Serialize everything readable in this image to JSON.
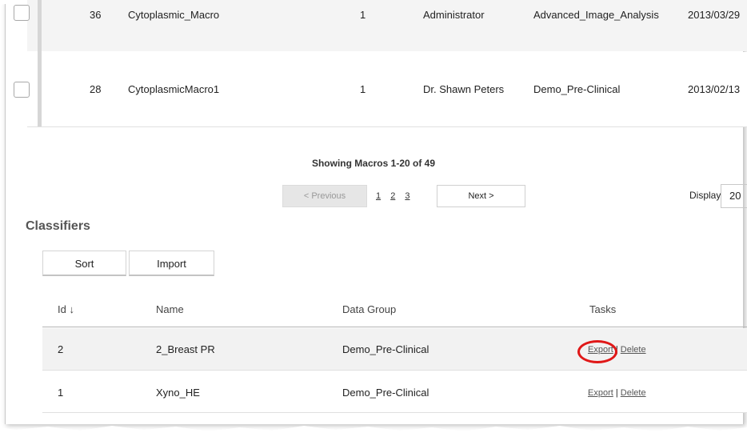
{
  "macros": {
    "rows": [
      {
        "id": "36",
        "name": "Cytoplasmic_Macro",
        "version": "1",
        "owner": "Administrator",
        "data_group": "Advanced_Image_Analysis",
        "date": "2013/03/29"
      },
      {
        "id": "28",
        "name": "CytoplasmicMacro1",
        "version": "1",
        "owner": "Dr. Shawn Peters",
        "data_group": "Demo_Pre-Clinical",
        "date": "2013/02/13"
      }
    ],
    "showing_text": "Showing Macros 1-20 of 49",
    "pagination": {
      "previous_label": "<   Previous",
      "pages": [
        "1",
        "2",
        "3"
      ],
      "next_label": "Next     >"
    },
    "display_label": "Display",
    "display_value": "20"
  },
  "classifiers": {
    "title": "Classifiers",
    "sort_label": "Sort",
    "import_label": "Import",
    "headers": {
      "id": "Id ↓",
      "name": "Name",
      "data_group": "Data Group",
      "tasks": "Tasks"
    },
    "rows": [
      {
        "id": "2",
        "name": "2_Breast PR",
        "data_group": "Demo_Pre-Clinical",
        "export": "Export",
        "sep": "|",
        "delete": "Delete"
      },
      {
        "id": "1",
        "name": "Xyno_HE",
        "data_group": "Demo_Pre-Clinical",
        "export": "Export",
        "sep": "|",
        "delete": "Delete"
      }
    ]
  },
  "colors": {
    "highlight": "#e01818",
    "row_alt": "#f2f2f2",
    "border": "#d4d4d4"
  }
}
